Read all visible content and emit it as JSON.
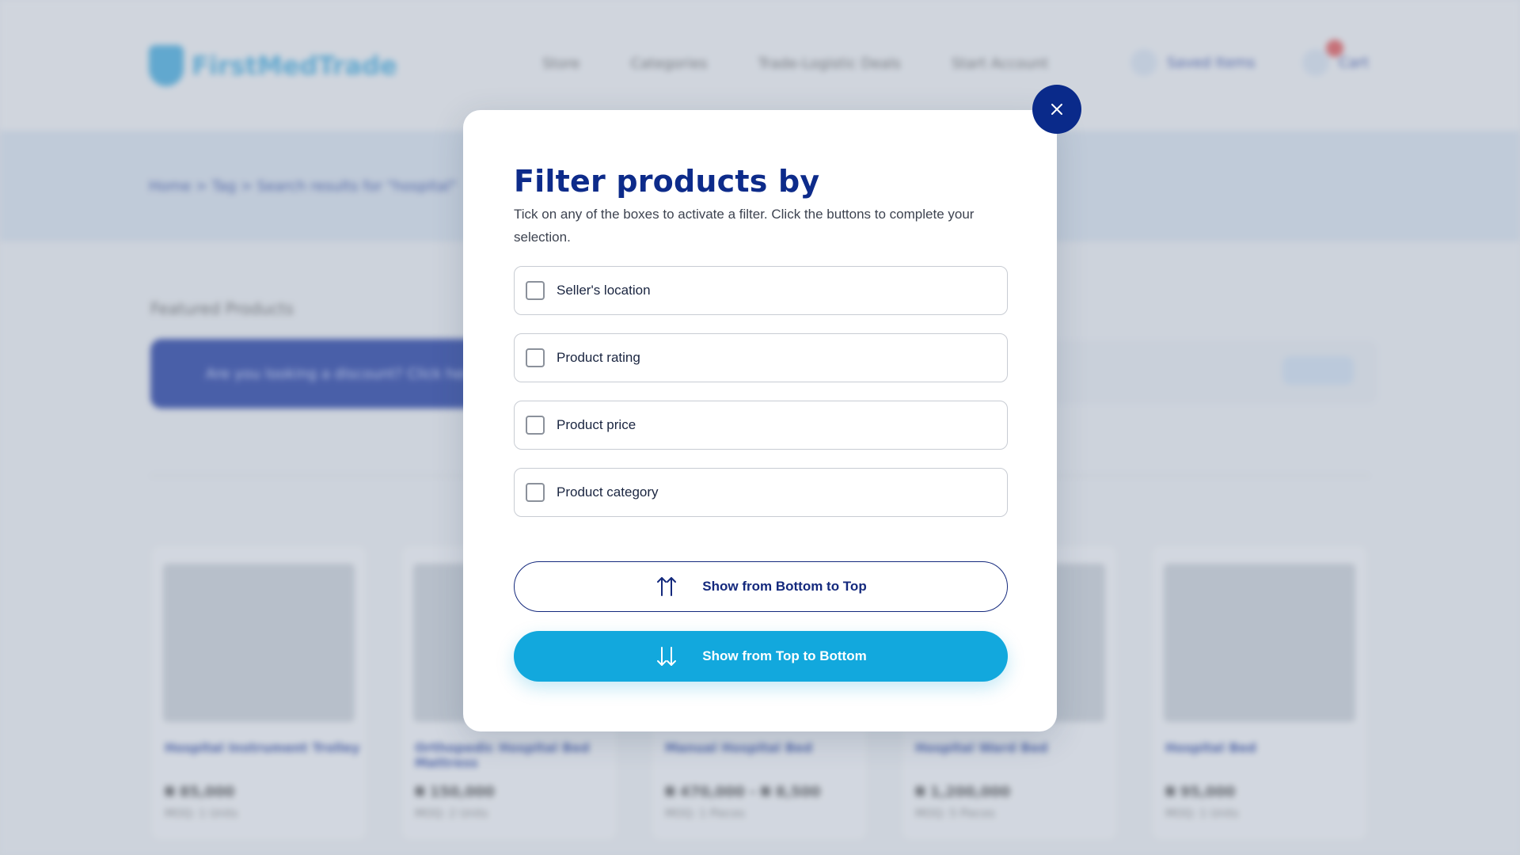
{
  "background": {
    "logo_text": "FirstMedTrade",
    "nav": [
      "Store",
      "Categories",
      "Trade-Logistic Deals",
      "Start Account"
    ],
    "header_account": "Saved Items",
    "header_cart": "Cart",
    "breadcrumbs": "Home  >  Tag  >  Search results for \"hospital\"",
    "section_title": "Featured Products",
    "promo_text": "Are you looking a discount? Click here to check out our offers",
    "products": [
      {
        "name": "Hospital Instrument Trolley",
        "price": "₦ 85,000",
        "sub": "MOQ: 1 Units"
      },
      {
        "name": "Orthopedic Hospital Bed Mattress",
        "price": "₦ 150,000",
        "sub": "MOQ: 2 Units"
      },
      {
        "name": "Manual Hospital Bed",
        "price": "₦ 470,000 - ₦ 8,500",
        "sub": "MOQ: 1 Pieces"
      },
      {
        "name": "Hospital Ward Bed",
        "price": "₦ 1,200,000",
        "sub": "MOQ: 5 Pieces"
      },
      {
        "name": "Hospital Bed",
        "price": "₦ 95,000",
        "sub": "MOQ: 1 Units"
      }
    ]
  },
  "modal": {
    "title": "Filter products by",
    "description": "Tick on any of the boxes to activate a filter. Click the buttons to complete your selection.",
    "options": [
      {
        "label": "Seller's location",
        "checked": false
      },
      {
        "label": "Product rating",
        "checked": false
      },
      {
        "label": "Product price",
        "checked": false
      },
      {
        "label": "Product category",
        "checked": false
      }
    ],
    "sort_asc_label": "Show from Bottom to Top",
    "sort_desc_label": "Show from Top to Bottom",
    "close_icon": "close-icon",
    "asc_icon": "sort-ascending-arrows-icon",
    "desc_icon": "sort-descending-arrows-icon"
  },
  "colors": {
    "title": "#0d2b8a",
    "close_button": "#0a2a8a",
    "primary_button": "#12a8dd",
    "outline_button": "#14297d"
  }
}
